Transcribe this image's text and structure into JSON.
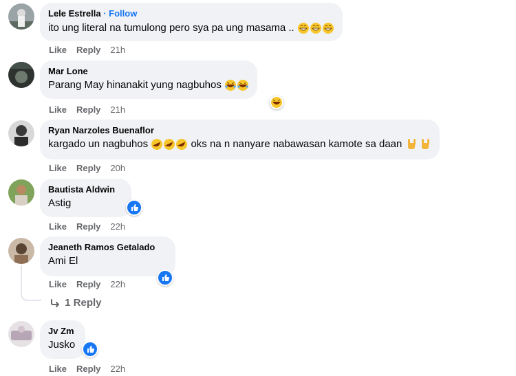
{
  "comments": [
    {
      "author": "Lele Estrella",
      "follow": "Follow",
      "text": "ito ung literal na tumulong pero sya pa ung masama ..",
      "like": "Like",
      "reply": "Reply",
      "time": "21h"
    },
    {
      "author": "Mar Lone",
      "text": "Parang May hinanakit yung nagbuhos",
      "like": "Like",
      "reply": "Reply",
      "time": "21h"
    },
    {
      "author": "Ryan Narzoles Buenaflor",
      "text": "kargado un nagbuhos",
      "text2": " oks na n nanyare nabawasan kamote sa daan",
      "like": "Like",
      "reply": "Reply",
      "time": "20h"
    },
    {
      "author": "Bautista Aldwin",
      "text": "Astig",
      "like": "Like",
      "reply": "Reply",
      "time": "22h"
    },
    {
      "author": "Jeaneth Ramos Getalado",
      "text": "Ami El",
      "like": "Like",
      "reply": "Reply",
      "time": "22h",
      "replies_label": "1 Reply"
    },
    {
      "author": "Jv Zm",
      "text": "Jusko",
      "like": "Like",
      "reply": "Reply",
      "time": "22h"
    }
  ],
  "icons": {
    "reaction": "like-icon",
    "laugh": "laugh-reaction-icon",
    "reply_arrow": "reply-arrow-icon"
  },
  "colors": {
    "bubble": "#f0f2f5",
    "link": "#1877f2",
    "meta": "#65676b"
  }
}
